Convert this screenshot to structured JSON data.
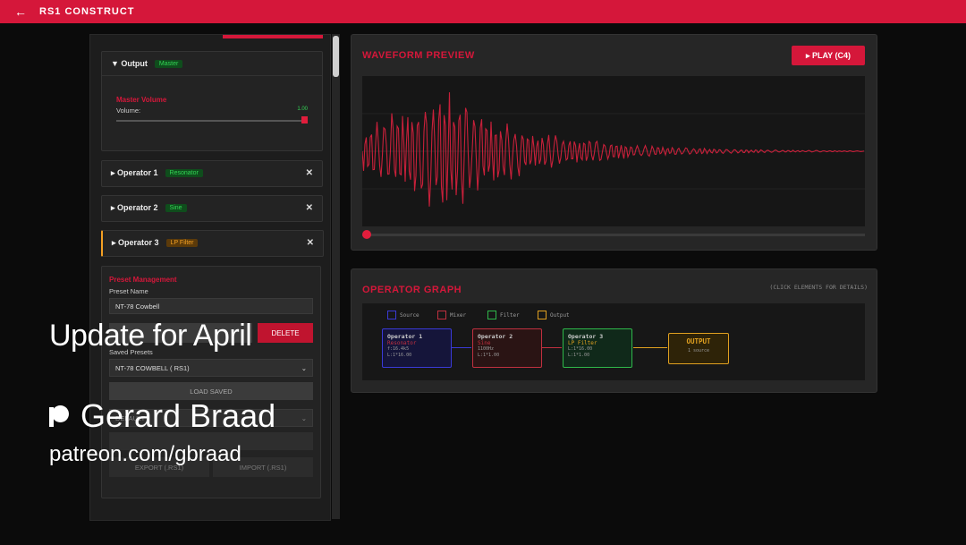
{
  "header": {
    "title": "RS1 CONSTRUCT",
    "back_icon": "←"
  },
  "output": {
    "label": "▼ Output",
    "badge": "Master",
    "section_title": "Master Volume",
    "volume_label": "Volume:",
    "volume_value": "1.00",
    "volume_level": 1.0
  },
  "operators": [
    {
      "label": "▸ Operator 1",
      "badge": "Resonator",
      "close": "✕"
    },
    {
      "label": "▸ Operator 2",
      "badge": "Sine",
      "close": "✕"
    },
    {
      "label": "▸ Operator 3",
      "badge": "LP Filter",
      "close": "✕"
    }
  ],
  "preset": {
    "title": "Preset Management",
    "name_label": "Preset Name",
    "name_value": "NT-78 Cowbell",
    "delete_label": "DELETE",
    "saved_label": "Saved Presets",
    "saved_selected": "NT-78 COWBELL ( RS1)",
    "load_label": "LOAD SAVED",
    "default_selected": "DEFAULT",
    "export_label": "EXPORT (.RS1)",
    "import_label": "IMPORT (.RS1)"
  },
  "waveform": {
    "title": "WAVEFORM PREVIEW",
    "play_label": "▸ PLAY (C4)",
    "position": 0.0,
    "accent": "#d5173a"
  },
  "graph": {
    "title": "OPERATOR GRAPH",
    "hint": "(CLICK ELEMENTS FOR DETAILS)",
    "legend": [
      {
        "label": "Source",
        "color": "#3a3ad6"
      },
      {
        "label": "Mixer",
        "color": "#c0303f"
      },
      {
        "label": "Filter",
        "color": "#2fb84a"
      },
      {
        "label": "Output",
        "color": "#e0a020"
      }
    ],
    "nodes": [
      {
        "title": "Operator 1",
        "subtitle": "Resonator",
        "p1": "f:16.4k5",
        "p2": "L:1*16.00",
        "color": "#3a3ad6",
        "subcolor": "#c0303f"
      },
      {
        "title": "Operator 2",
        "subtitle": "Sine",
        "p1": "1100Hz",
        "p2": "L:1*1.00",
        "color": "#c0303f",
        "subcolor": "#c0303f"
      },
      {
        "title": "Operator 3",
        "subtitle": "LP Filter",
        "p1": "L:1*16.00",
        "p2": "L:1*1.00",
        "color": "#2fb84a",
        "subcolor": "#e0a020"
      }
    ],
    "output_node": {
      "title": "OUTPUT",
      "subtitle": "1 source",
      "color": "#e0a020"
    }
  },
  "overlay": {
    "title": "Update for April",
    "author": "Gerard Braad",
    "url": "patreon.com/gbraad"
  }
}
